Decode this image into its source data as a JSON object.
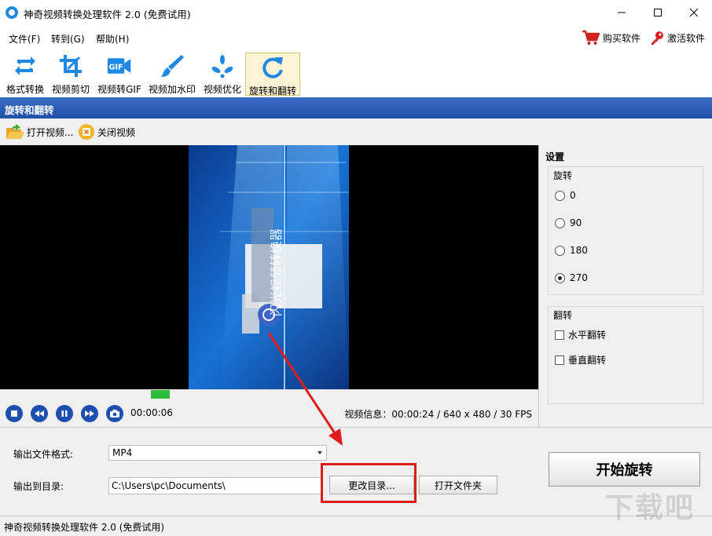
{
  "window": {
    "title": "神奇视频转换处理软件 2.0 (免费试用)"
  },
  "menu": {
    "items": [
      "文件(F)",
      "转到(G)",
      "帮助(H)"
    ],
    "buy": "购买软件",
    "activate": "激活软件"
  },
  "toolbar": {
    "tools": [
      {
        "label": "格式转换",
        "icon": "format-convert-icon"
      },
      {
        "label": "视频剪切",
        "icon": "crop-icon"
      },
      {
        "label": "视频转GIF",
        "icon": "gif-icon"
      },
      {
        "label": "视频加水印",
        "icon": "brush-icon"
      },
      {
        "label": "视频优化",
        "icon": "optimize-icon"
      },
      {
        "label": "旋转和翻转",
        "icon": "rotate-icon",
        "active": true
      }
    ],
    "gif_text": "GIF"
  },
  "section": {
    "title": "旋转和翻转"
  },
  "subtoolbar": {
    "open": "打开视频...",
    "close": "关闭视频"
  },
  "video": {
    "frame_text": "闪光视频转换器"
  },
  "player": {
    "progress_fraction": 0.25,
    "current_time": "00:00:06",
    "info": "视频信息：00:00:24 / 640 x 480 / 30 FPS"
  },
  "settings": {
    "title": "设置",
    "rotate": {
      "title": "旋转",
      "options": [
        "0",
        "90",
        "180",
        "270"
      ],
      "selected": "270"
    },
    "flip": {
      "title": "翻转",
      "horizontal": "水平翻转",
      "vertical": "垂直翻转",
      "horizontal_checked": false,
      "vertical_checked": false
    }
  },
  "output": {
    "format_label": "输出文件格式:",
    "format_value": "MP4",
    "dir_label": "输出到目录:",
    "dir_value": "C:\\Users\\pc\\Documents\\",
    "change_dir": "更改目录...",
    "open_folder": "打开文件夹",
    "start": "开始旋转"
  },
  "status": {
    "text": "神奇视频转换处理软件 2.0 (免费试用)"
  },
  "watermark": {
    "text": "下载吧"
  },
  "colors": {
    "accent_blue": "#1f50a8",
    "highlight_red": "#e01b1b",
    "progress_green": "#2ebd3b"
  }
}
